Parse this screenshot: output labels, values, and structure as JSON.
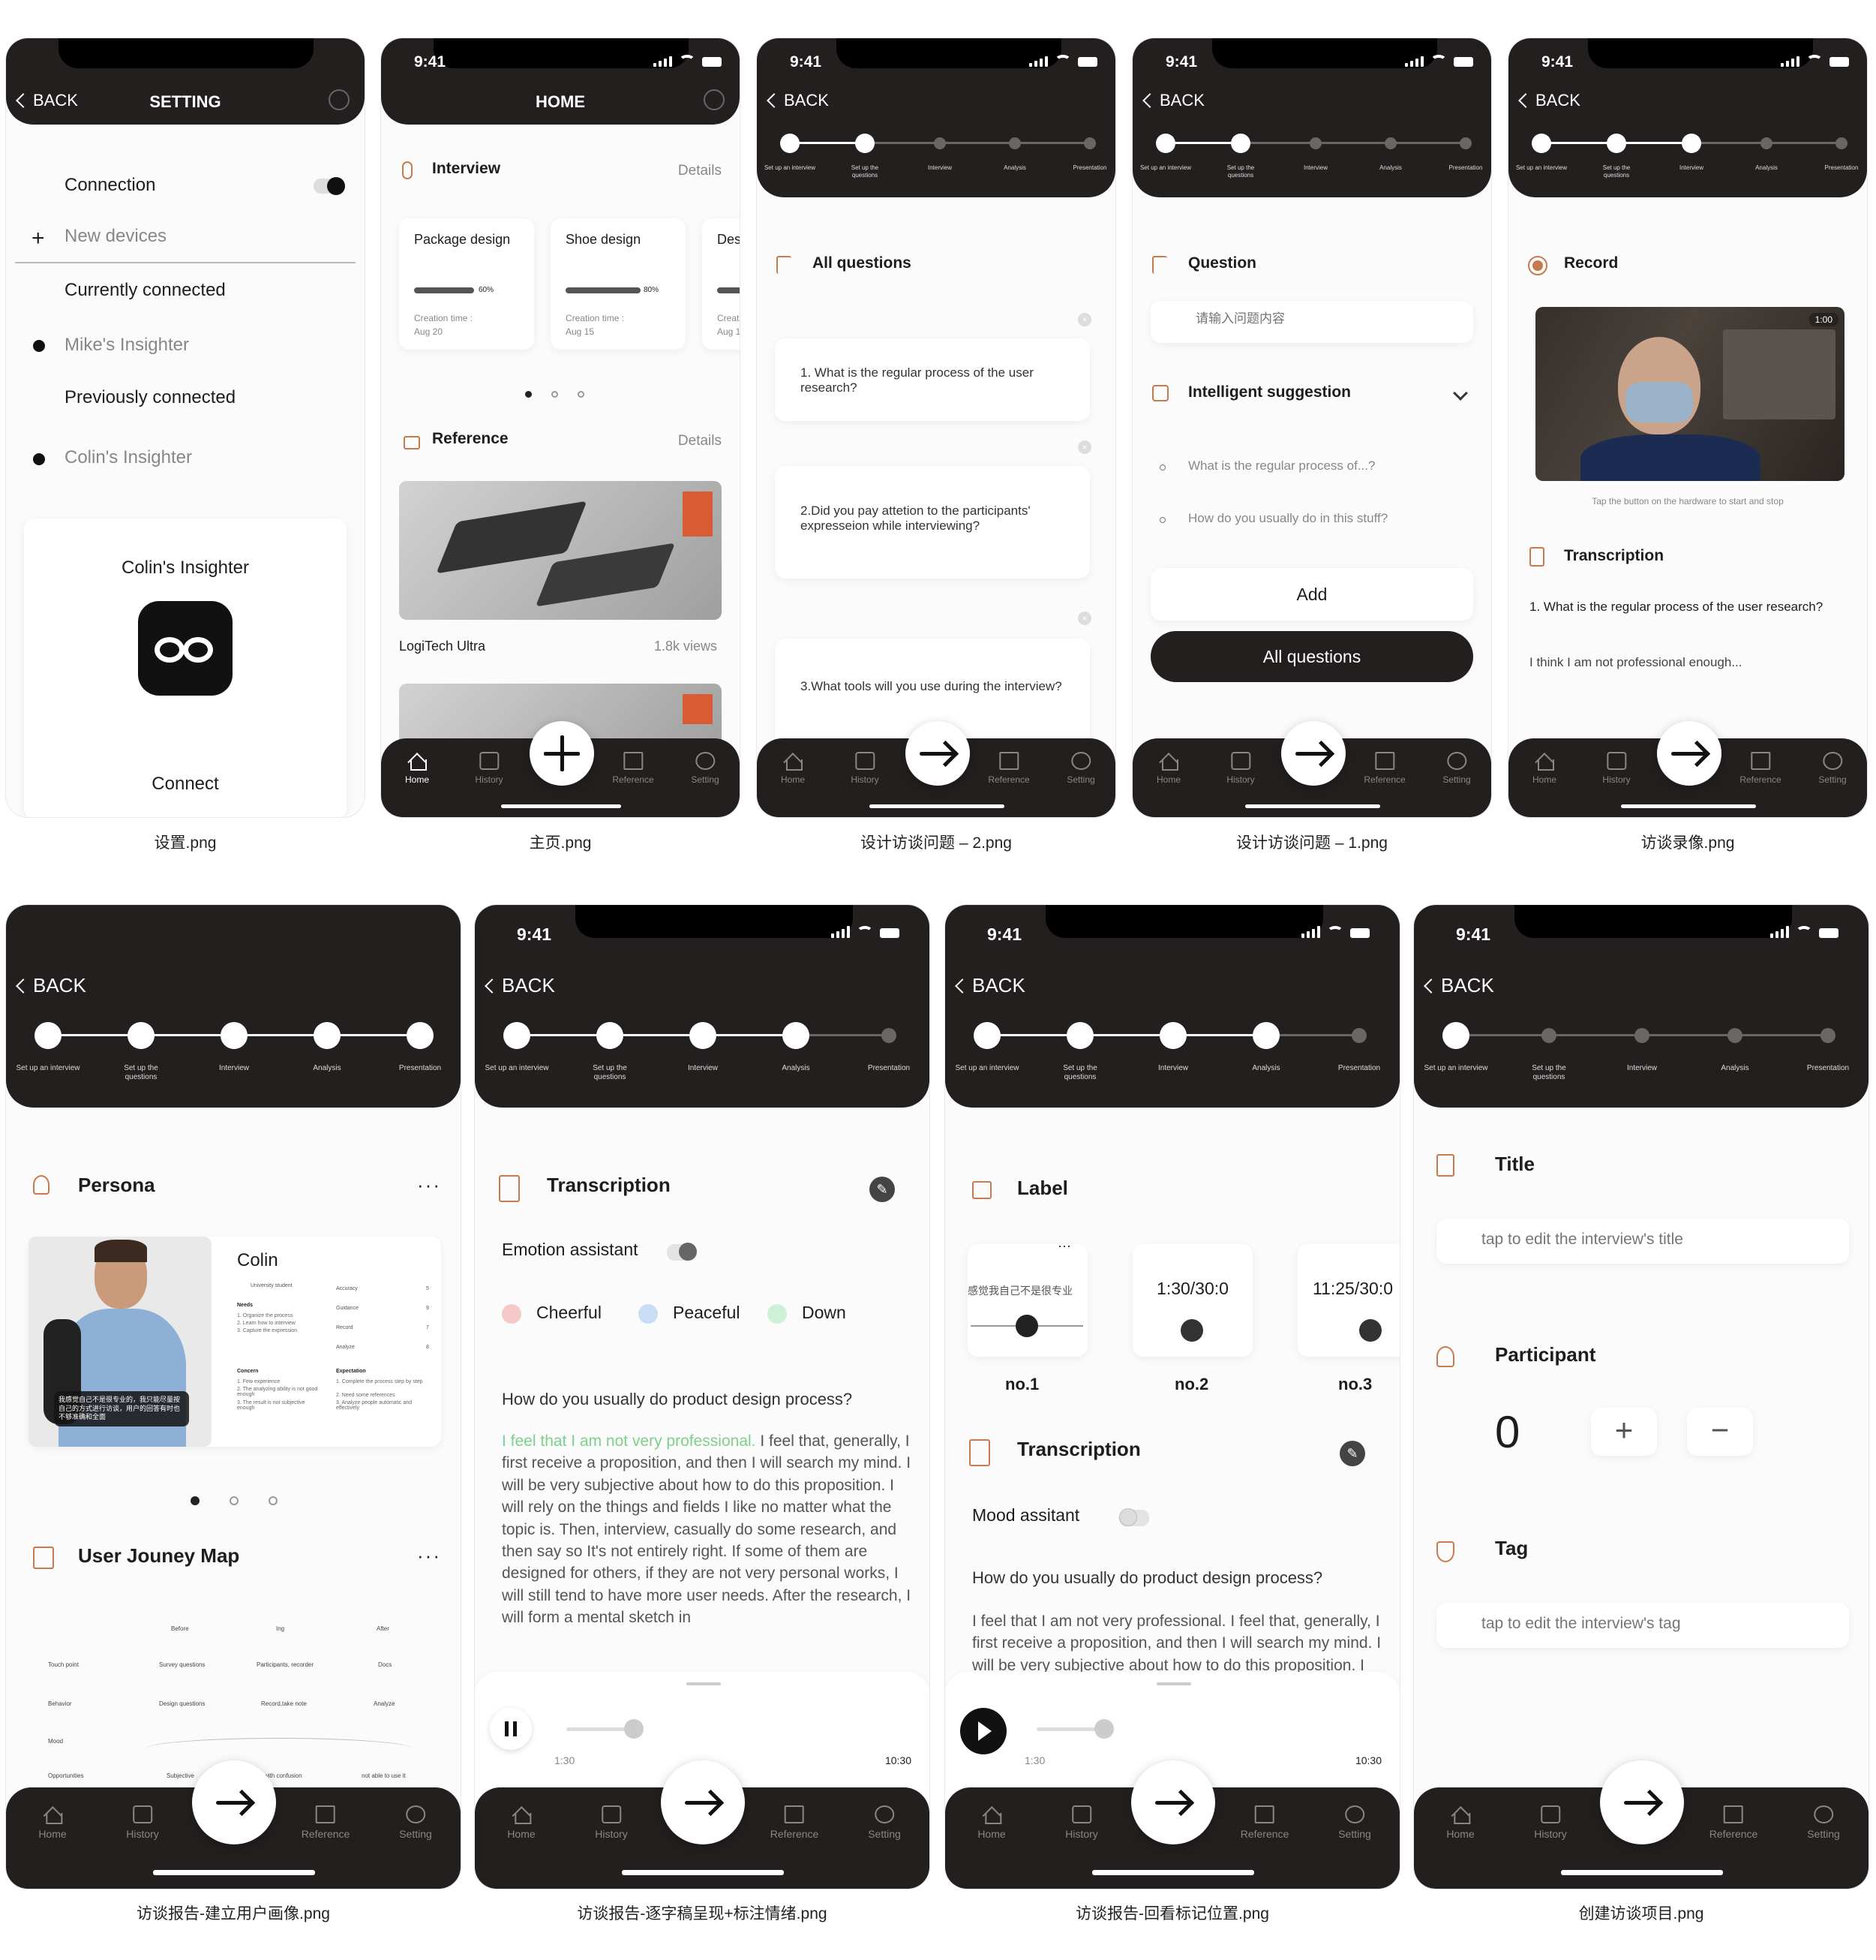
{
  "time": "9:41",
  "back": "BACK",
  "progress_steps": [
    "Set up an interview",
    "Set up the questions",
    "Interview",
    "Analysis",
    "Presentation"
  ],
  "tabs": [
    "Home",
    "History",
    "Reference",
    "Setting"
  ],
  "captions": [
    "设置.png",
    "主页.png",
    "设计访谈问题 – 2.png",
    "设计访谈问题 – 1.png",
    "访谈录像.png",
    "访谈报告-建立用户画像.png",
    "访谈报告-逐字稿呈现+标注情绪.png",
    "访谈报告-回看标记位置.png",
    "创建访谈项目.png"
  ],
  "setting": {
    "title": "SETTING",
    "connection": "Connection",
    "new_devices": "New devices",
    "currently": "Currently connected",
    "mike": "Mike's Insighter",
    "previously": "Previously connected",
    "colin": "Colin's Insighter",
    "card_title": "Colin's Insighter",
    "connect": "Connect"
  },
  "home": {
    "title": "HOME",
    "interview": "Interview",
    "details": "Details",
    "cards": [
      {
        "name": "Package design",
        "pct": "60%",
        "progress": 0.6,
        "created": "Creation time :",
        "date": "Aug 20"
      },
      {
        "name": "Shoe design",
        "pct": "80%",
        "progress": 0.8,
        "created": "Creation time :",
        "date": "Aug 15"
      },
      {
        "name": "Des",
        "pct": "",
        "progress": 0.3,
        "created": "Creat",
        "date": "Aug 1"
      }
    ],
    "reference": "Reference",
    "ref_name": "LogiTech Ultra",
    "ref_views": "1.8k views"
  },
  "q2": {
    "title": "All questions",
    "questions": [
      "1. What is the regular process of the user research?",
      "2.Did you pay attetion to the participants' expresseion while interviewing?",
      "3.What tools will you use during the interview?"
    ]
  },
  "q1": {
    "question": "Question",
    "placeholder": "请输入问题内容",
    "suggest": "Intelligent suggestion",
    "s1": "What is the regular process of...?",
    "s2": "How do you usually do in this stuff?",
    "add": "Add",
    "all": "All questions"
  },
  "rec": {
    "record": "Record",
    "timer": "1:00",
    "hint": "Tap the button on the hardware to start and stop",
    "transcription": "Transcription",
    "q": "1. What is the regular process of the user research?",
    "a": "I think I am not professional enough..."
  },
  "persona": {
    "persona": "Persona",
    "name": "Colin",
    "role": "University student",
    "needs": "Needs",
    "needs_items": [
      "1. Organize the process",
      "2. Learn how to interview",
      "3. Capture the expression"
    ],
    "concern": "Concern",
    "concern_items": [
      "1. Few experience",
      "2. The analyzing ability is not good enough",
      "3. The result is not subjective enough"
    ],
    "expectation": "Expectation",
    "expect_items": [
      "1. Complete the process step by step",
      "2. Need some references",
      "3. Analyze people automatic and effectively"
    ],
    "metrics": [
      "Accuracy",
      "Guidance",
      "Record",
      "Analyze"
    ],
    "metric_vals": [
      "5",
      "9",
      "7",
      "8"
    ],
    "quote": "我感觉自己不是很专业的，我只能尽量按自己的方式进行访谈，用户的回答有时也不够准确和全面",
    "journey": "User Jouney Map",
    "stages": [
      "Before",
      "Ing",
      "After"
    ],
    "rows": [
      "Touch point",
      "Behavior",
      "Mood",
      "Opportunities"
    ],
    "cells": [
      "Survey questions",
      "Participants, recorder",
      "Docs",
      "Design questions",
      "Record,take note",
      "Analyze",
      "Subjective",
      "with confusion",
      "not able to use it"
    ]
  },
  "emotion": {
    "transcription": "Transcription",
    "assistant": "Emotion assistant",
    "moods": [
      "Cheerful",
      "Peaceful",
      "Down"
    ],
    "mood_colors": [
      "#f6c9c9",
      "#c9def6",
      "#cdf1d6"
    ],
    "question": "How do you usually do product design process?",
    "hl": "I feel that I am not very professional.",
    "rest": " I feel that, generally, I first receive a proposition, and then I will search my mind. I will be very subjective about how to do this proposition. I will rely on the things and fields I like no matter what the topic is. Then, interview, casually do some research, and then say so It's not entirely right. If some of them are designed for others, if they are not very personal works, I will still tend to have more user needs. After the research, I will form a mental sketch in",
    "start": "1:30",
    "end": "10:30",
    "position": 0.5
  },
  "label": {
    "label": "Label",
    "clips": [
      {
        "time": "感觉我自己不是很专业",
        "name": "no.1"
      },
      {
        "time": "1:30/30:0",
        "name": "no.2"
      },
      {
        "time": "11:25/30:0",
        "name": "no.3"
      }
    ],
    "transcription": "Transcription",
    "mood": "Mood assitant",
    "question": "How do you usually do product design process?",
    "text": "I feel that I am not very professional. I feel that, generally, I first receive a proposition, and then I will search my mind. I will be very subjective about how to do this proposition. I will rely on the things",
    "start": "1:30",
    "end": "10:30",
    "position": 0.5
  },
  "create": {
    "title": "Title",
    "title_ph": "tap to edit the interview's title",
    "participant": "Participant",
    "count": "0",
    "tag": "Tag",
    "tag_ph": "tap to edit the interview's tag"
  }
}
